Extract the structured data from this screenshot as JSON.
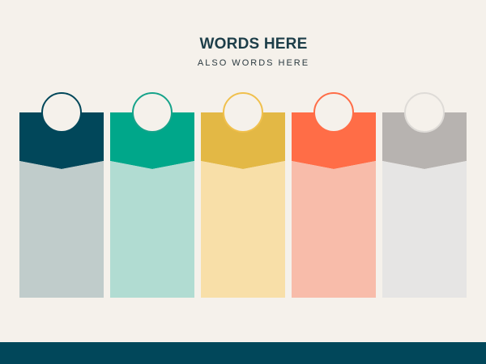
{
  "header": {
    "title": "WORDS HERE",
    "subtitle": "ALSO WORDS HERE"
  },
  "colors": {
    "background": "#f5f1eb",
    "footer": "#01475a",
    "text_dark": "#1d3e49"
  },
  "columns": [
    {
      "top_color": "#01475a",
      "body_color": "#c0cccb",
      "ring_color": "#01475a"
    },
    {
      "top_color": "#00a78a",
      "body_color": "#b1dcd2",
      "ring_color": "#16a38a"
    },
    {
      "top_color": "#e3b845",
      "body_color": "#f8dfa8",
      "ring_color": "#f0c04d"
    },
    {
      "top_color": "#ff6d47",
      "body_color": "#f8bcaa",
      "ring_color": "#ff6d47"
    },
    {
      "top_color": "#b7b3b0",
      "body_color": "#e6e5e4",
      "ring_color": "#dedbd7"
    }
  ]
}
